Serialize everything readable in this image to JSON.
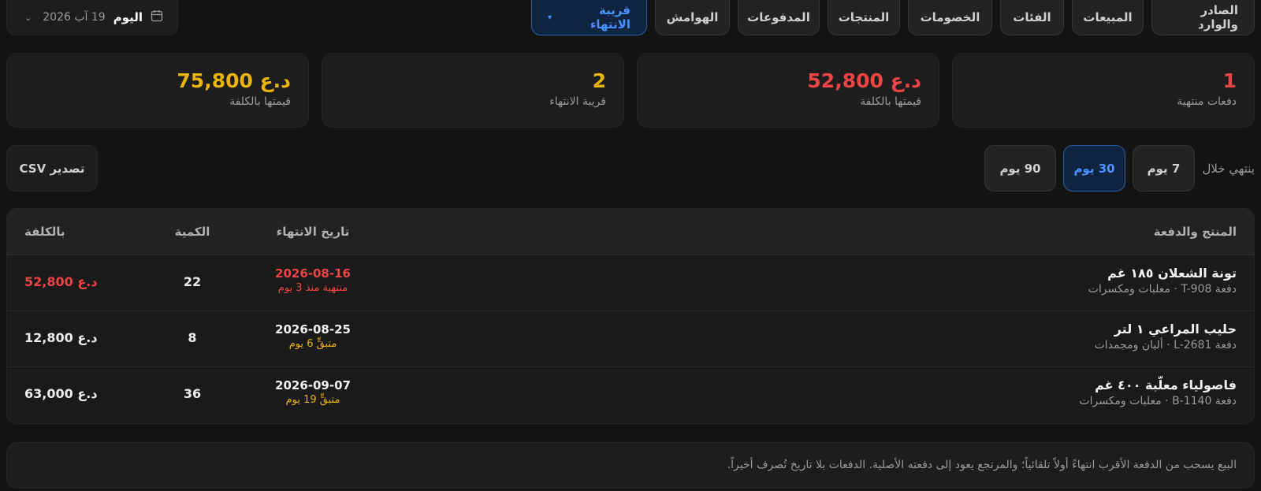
{
  "tabs": [
    {
      "label": "الصادر والوارد"
    },
    {
      "label": "المبيعات"
    },
    {
      "label": "الفئات"
    },
    {
      "label": "الخصومات"
    },
    {
      "label": "المنتجات"
    },
    {
      "label": "المدفوعات"
    },
    {
      "label": "الهوامش"
    },
    {
      "label": "قريبة الانتهاء",
      "active": true
    }
  ],
  "date_picker": {
    "today_label": "اليوم",
    "date": "19 آب 2026"
  },
  "cards": [
    {
      "value": "1",
      "label": "دفعات منتهية"
    },
    {
      "value": "د.ع 52,800",
      "label": "قيمتها بالكلفة"
    },
    {
      "value": "2",
      "label": "قريبة الانتهاء"
    },
    {
      "value": "د.ع 75,800",
      "label": "قيمتها بالكلفة"
    }
  ],
  "period": {
    "label": "ينتهي خلال",
    "options": [
      "7 يوم",
      "30 يوم",
      "90 يوم"
    ],
    "selected": "30 يوم"
  },
  "export_label": "تصدير CSV",
  "table": {
    "headers": {
      "product": "المنتج والدفعة",
      "expiry": "تاريخ الانتهاء",
      "qty": "الكمية",
      "cost": "بالكلفة"
    },
    "rows": [
      {
        "name": "تونة الشعلان ١٨٥ غم",
        "sub": "دفعة T-908 · معلبات ومكسرات",
        "date": "2026-08-16",
        "status": "منتهية منذ 3 يوم",
        "qty": "22",
        "cost": "د.ع 52,800"
      },
      {
        "name": "حليب المراعي ١ لتر",
        "sub": "دفعة L-2681 · ألبان ومجمدات",
        "date": "2026-08-25",
        "status": "متبقٍّ 6 يوم",
        "qty": "8",
        "cost": "د.ع 12,800"
      },
      {
        "name": "فاصولياء معلّبة ٤٠٠ غم",
        "sub": "دفعة B-1140 · معلبات ومكسرات",
        "date": "2026-09-07",
        "status": "متبقٍّ 19 يوم",
        "qty": "36",
        "cost": "د.ع 63,000"
      }
    ]
  },
  "note": "البيع يسحب من الدفعة الأقرب انتهاءً أولاً تلقائياً؛ والمرتجع يعود إلى دفعته الأصلية. الدفعات بلا تاريخ تُصرف أخيراً.",
  "colors": {
    "bg": "#131313",
    "accent": "#4a93ff",
    "danger": "#ef4444",
    "warning": "#eab308"
  }
}
